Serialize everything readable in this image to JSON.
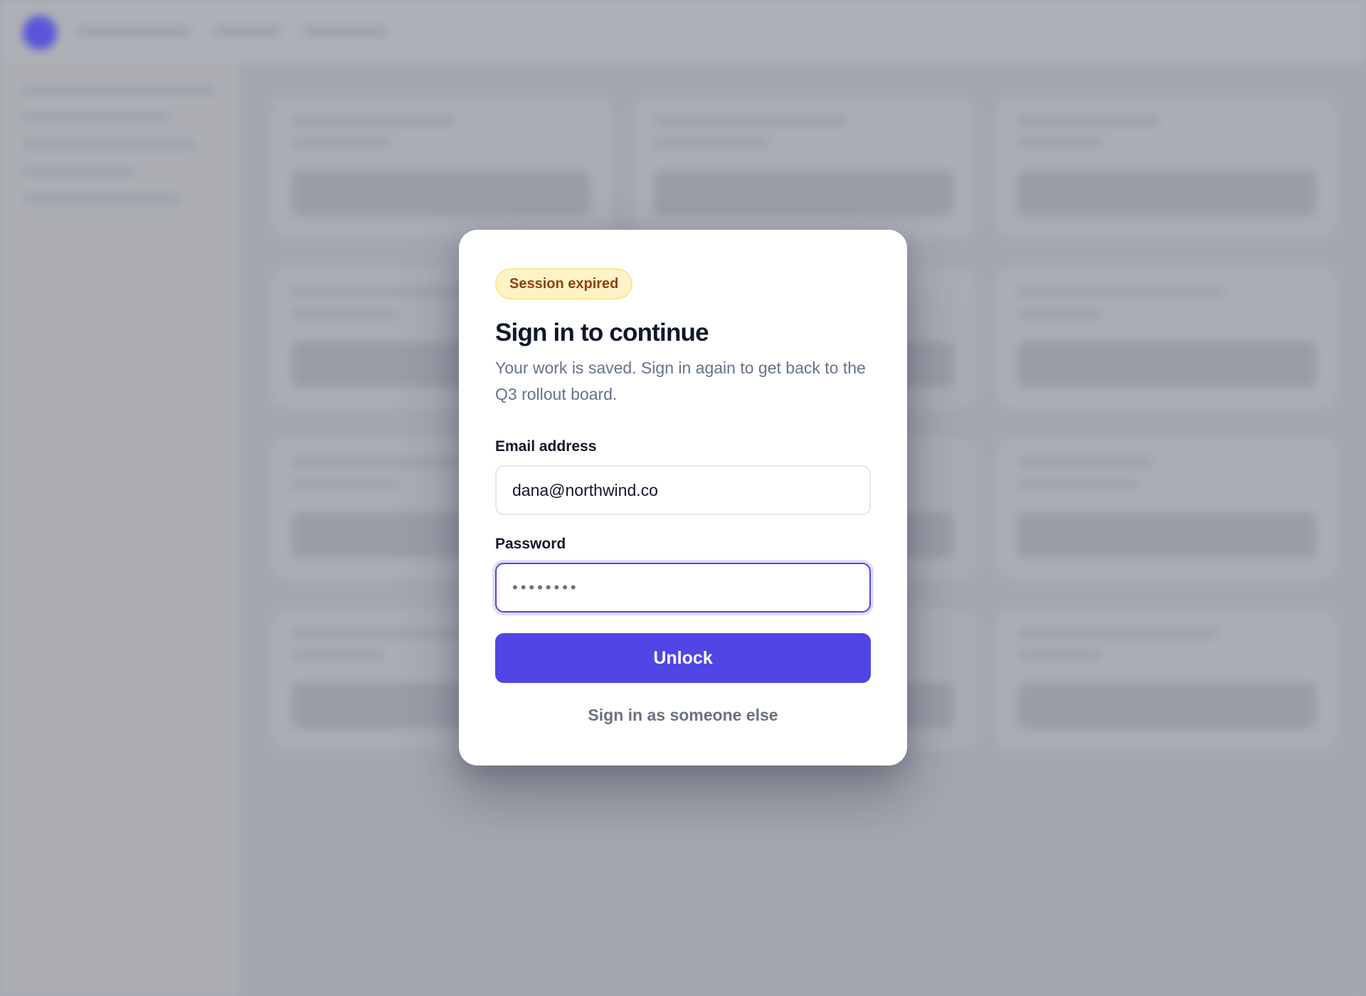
{
  "modal": {
    "badge": "Session expired",
    "title": "Sign in to continue",
    "subtitle": "Your work is saved. Sign in again to get back to the Q3 rollout board.",
    "email": {
      "label": "Email address",
      "value": "dana@northwind.co"
    },
    "password": {
      "label": "Password",
      "value": "••••••••"
    },
    "submit_label": "Unlock",
    "alt_link": "Sign in as someone else"
  },
  "colors": {
    "accent": "#4f46e5",
    "badge_bg": "#fef3c7",
    "badge_text": "#92400e"
  }
}
